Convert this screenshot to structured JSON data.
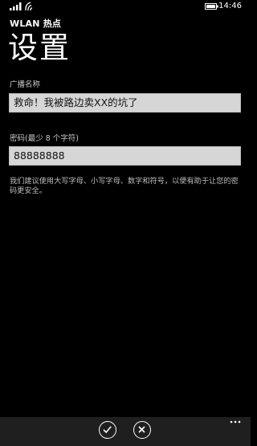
{
  "status_bar": {
    "time": "14:46",
    "icons": [
      "signal-icon",
      "wifi-icon",
      "battery-icon"
    ]
  },
  "header": {
    "app_title": "WLAN 热点",
    "page_title": "设置"
  },
  "form": {
    "ssid": {
      "label": "广播名称",
      "value": "救命！我被路边卖XX的坑了"
    },
    "password": {
      "label": "密码(最少 8 个字符)",
      "value": "88888888"
    },
    "hint": "我们建议使用大写字母、小写字母、数字和符号，以便有助于让您的密码更安全。"
  },
  "app_bar": {
    "buttons": [
      "check-icon",
      "close-icon"
    ],
    "more": "more-icon"
  },
  "colors": {
    "background": "#000000",
    "input_background": "#d6d6d6",
    "app_bar": "#1f1f1f",
    "label": "#c8c8c8"
  }
}
